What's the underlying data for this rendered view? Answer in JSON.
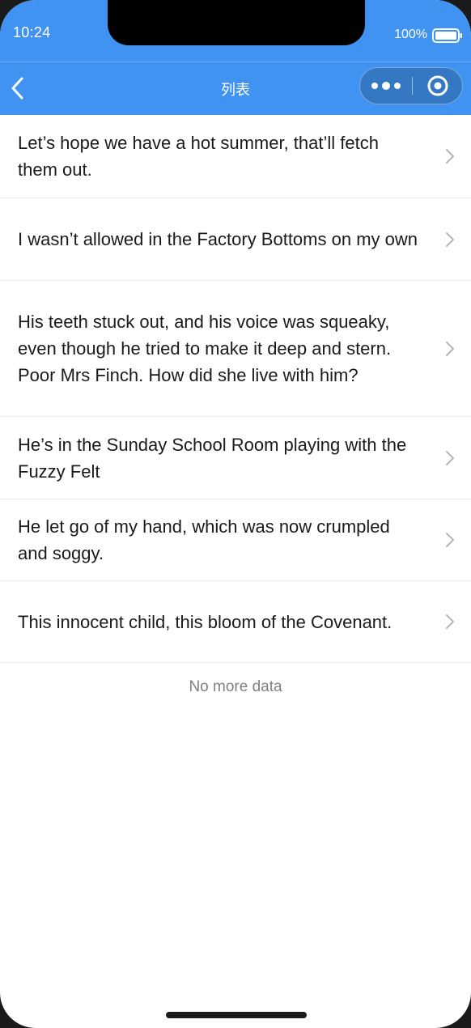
{
  "status_bar": {
    "time": "10:24",
    "battery_percent": "100%"
  },
  "nav": {
    "title": "列表",
    "back_icon": "chevron-left-icon",
    "more_icon": "more-dots-icon",
    "close_icon": "target-circle-icon"
  },
  "list": {
    "items": [
      {
        "text": "Let’s hope we have a hot summer, that’ll fetch them out."
      },
      {
        "text": "I wasn’t allowed in the Factory Bottoms on my own"
      },
      {
        "text": "His teeth stuck out, and his voice was squeaky, even though he tried to make it deep and stern. Poor Mrs Finch. How did she live with him?"
      },
      {
        "text": "He’s in the Sunday School Room playing with the Fuzzy Felt"
      },
      {
        "text": "He let go of my hand, which was now crumpled and soggy."
      },
      {
        "text": "This innocent child, this bloom of the Covenant."
      }
    ],
    "footer": "No more data"
  },
  "colors": {
    "header_bg": "#4093f0",
    "text": "#1a1a1a",
    "muted": "#808080",
    "divider": "#e8e8e8"
  }
}
